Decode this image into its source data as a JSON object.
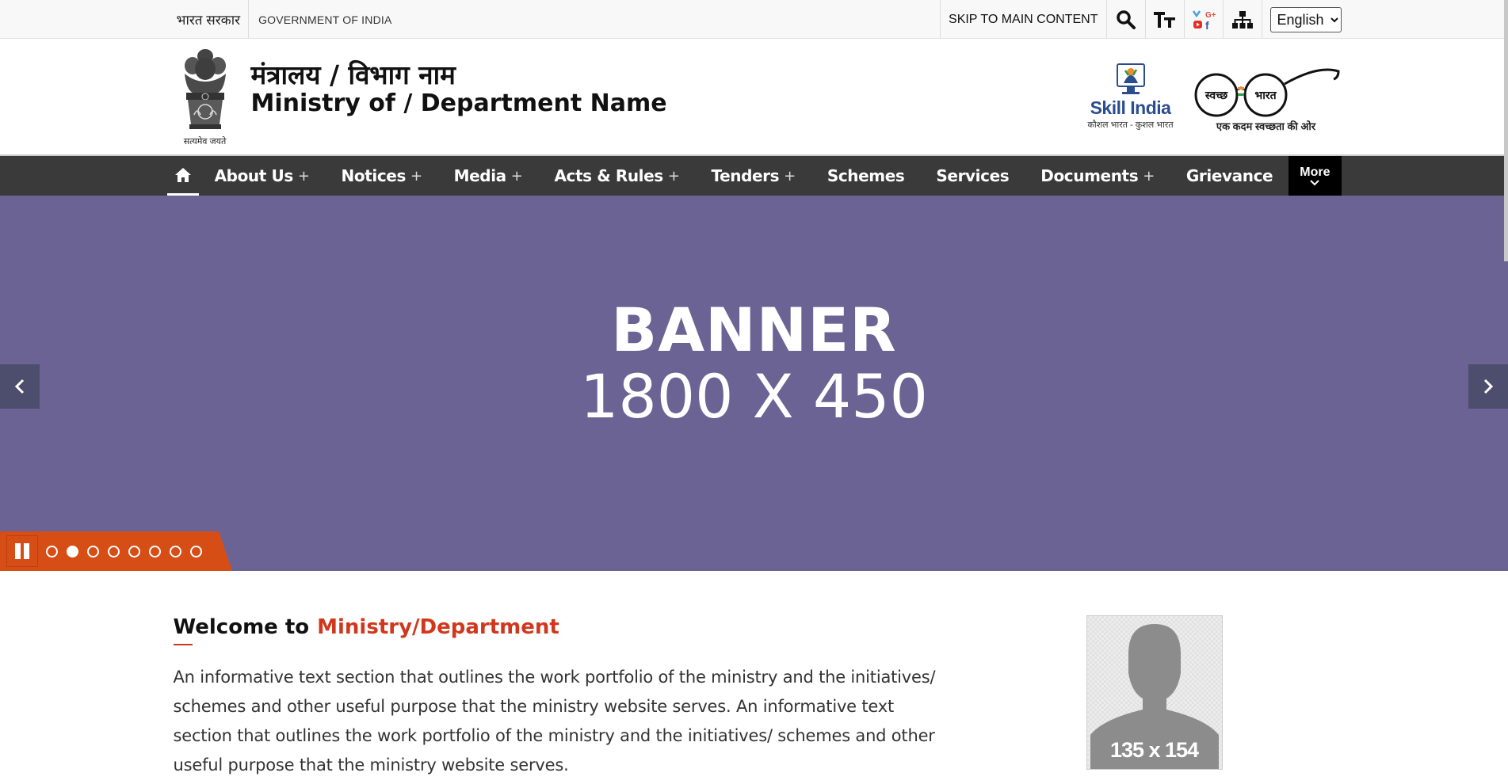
{
  "topbar": {
    "hindi_gov": "भारत सरकार",
    "eng_gov": "GOVERNMENT OF INDIA",
    "skip_link": "SKIP TO MAIN CONTENT",
    "language": "English",
    "icons": [
      "search-icon",
      "text-size-icon",
      "social-media-icon",
      "sitemap-icon"
    ]
  },
  "header": {
    "emblem_caption": "सत्यमेव जयते",
    "title_hindi": "मंत्रालय / विभाग नाम",
    "title_english": "Ministry of / Department Name",
    "skill_india_title": "Skill India",
    "skill_india_sub": "कौशल भारत - कुशल भारत",
    "swachh_left": "स्वच्छ",
    "swachh_right": "भारत",
    "swachh_sub": "एक कदम स्वच्छता की ओर"
  },
  "nav": {
    "items": [
      {
        "label": "About Us",
        "has_sub": "+"
      },
      {
        "label": "Notices",
        "has_sub": "+"
      },
      {
        "label": "Media",
        "has_sub": "+"
      },
      {
        "label": "Acts & Rules",
        "has_sub": "+"
      },
      {
        "label": "Tenders",
        "has_sub": "+"
      },
      {
        "label": "Schemes"
      },
      {
        "label": "Services"
      },
      {
        "label": "Documents",
        "has_sub": "+"
      },
      {
        "label": "Grievance"
      }
    ],
    "more": "More"
  },
  "banner": {
    "line1": "BANNER",
    "line2": "1800 X 450",
    "background": "#6c6395",
    "slide_count": 8,
    "active_slide": 2
  },
  "welcome": {
    "heading_prefix": "Welcome to",
    "heading_highlight": "Ministry/Department",
    "body": "An informative text section that outlines the work portfolio of the ministry and the initiatives/ schemes and other useful purpose that the ministry website serves. An informative text section that outlines the work portfolio of the ministry and the initiatives/ schemes and other useful purpose that the ministry website serves.",
    "portrait_label": "135 x 154"
  },
  "colors": {
    "accent": "#d0381e",
    "nav_bg": "#3a3a3a",
    "slider_control": "#d64e16"
  }
}
